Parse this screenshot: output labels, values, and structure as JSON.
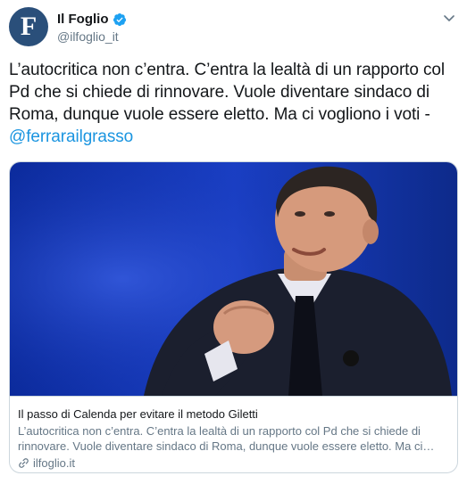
{
  "colors": {
    "accent": "#1b95e0",
    "avatar_bg": "#2a4f7a",
    "muted": "#657786"
  },
  "author": {
    "avatar_letter": "F",
    "display_name": "Il Foglio",
    "handle": "@ilfoglio_it",
    "verified_icon": "verified-badge-icon"
  },
  "menu_icon": "chevron-down-icon",
  "tweet": {
    "text": "L’autocritica non c’entra. C’entra la lealtà di un rapporto col Pd che si chiede di rinnovare. Vuole diventare sindaco di Roma, dunque vuole essere eletto. Ma ci vogliono i voti - ",
    "mention": "@ferrarailgrasso"
  },
  "card": {
    "title": "Il passo di Calenda per evitare il metodo Giletti",
    "description": "L’autocritica non c’entra. C’entra la lealtà di un rapporto col Pd che si chiede di rinnovare. Vuole diventare sindaco di Roma, dunque vuole essere eletto. Ma ci…",
    "domain": "ilfoglio.it",
    "domain_icon": "link-icon"
  }
}
